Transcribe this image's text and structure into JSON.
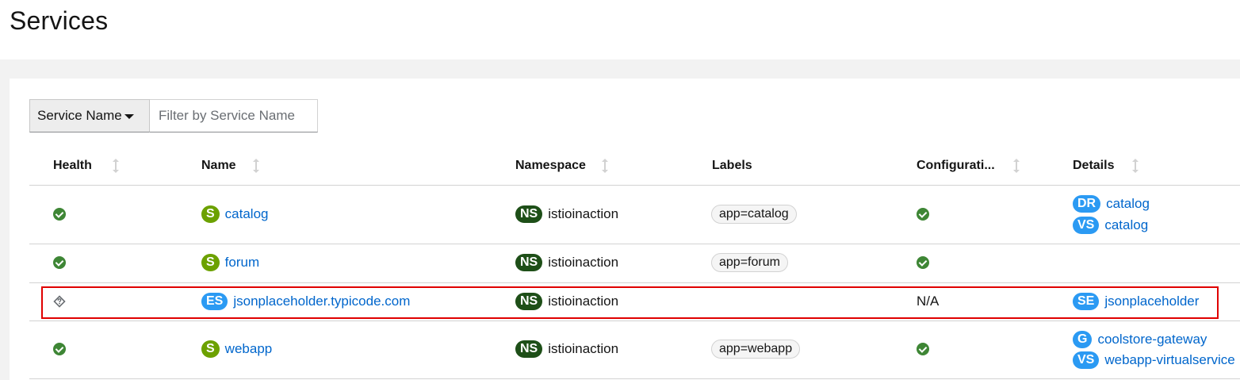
{
  "page": {
    "title": "Services"
  },
  "filter": {
    "dropdown_label": "Service Name",
    "placeholder": "Filter by Service Name"
  },
  "columns": {
    "health": "Health",
    "name": "Name",
    "namespace": "Namespace",
    "labels": "Labels",
    "configuration": "Configurati...",
    "details": "Details"
  },
  "colors": {
    "link": "#0066cc",
    "health_ok": "#3e8635",
    "service_badge": "#6ca100",
    "entity_badge": "#2b9af3",
    "namespace_badge": "#1e4f18",
    "highlight": "#e00000"
  },
  "rows": [
    {
      "health": "check-circle-icon",
      "name_badge": "S",
      "name": "catalog",
      "ns_badge": "NS",
      "namespace": "istioinaction",
      "label": "app=catalog",
      "config": "check-circle-icon",
      "details": [
        {
          "badge": "DR",
          "text": "catalog"
        },
        {
          "badge": "VS",
          "text": "catalog"
        }
      ]
    },
    {
      "health": "check-circle-icon",
      "name_badge": "S",
      "name": "forum",
      "ns_badge": "NS",
      "namespace": "istioinaction",
      "label": "app=forum",
      "config": "check-circle-icon",
      "details": []
    },
    {
      "health": "unknown-icon",
      "name_badge": "ES",
      "name": "jsonplaceholder.typicode.com",
      "ns_badge": "NS",
      "namespace": "istioinaction",
      "label": "",
      "config": "N/A",
      "details": [
        {
          "badge": "SE",
          "text": "jsonplaceholder"
        }
      ]
    },
    {
      "health": "check-circle-icon",
      "name_badge": "S",
      "name": "webapp",
      "ns_badge": "NS",
      "namespace": "istioinaction",
      "label": "app=webapp",
      "config": "check-circle-icon",
      "details": [
        {
          "badge": "G",
          "text": "coolstore-gateway"
        },
        {
          "badge": "VS",
          "text": "webapp-virtualservice"
        }
      ]
    }
  ]
}
